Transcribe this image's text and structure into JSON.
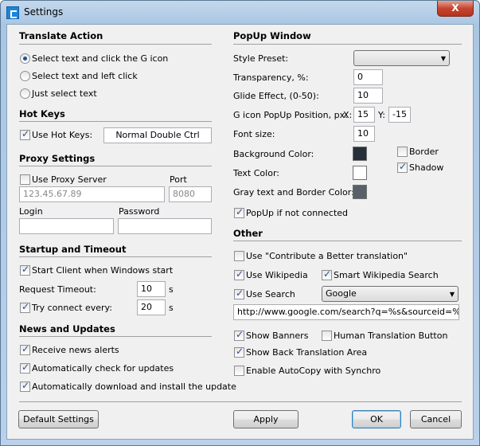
{
  "window": {
    "title": "Settings",
    "close": "X"
  },
  "translate": {
    "heading": "Translate Action",
    "options": [
      {
        "label": "Select text and click the G icon",
        "selected": true
      },
      {
        "label": "Select text and left click",
        "selected": false
      },
      {
        "label": "Just select text",
        "selected": false
      }
    ]
  },
  "hotkeys": {
    "heading": "Hot Keys",
    "use_label": "Use Hot Keys:",
    "checked": true,
    "value": "Normal Double Ctrl"
  },
  "proxy": {
    "heading": "Proxy Settings",
    "use_label": "Use Proxy Server",
    "port_label": "Port",
    "address": "123.45.67.89",
    "port": "8080",
    "login_label": "Login",
    "password_label": "Password",
    "login": "",
    "password": ""
  },
  "startup": {
    "heading": "Startup and Timeout",
    "start_label": "Start Client when Windows start",
    "timeout_label": "Request Timeout:",
    "timeout": "10",
    "unit": "s",
    "try_label": "Try connect every:",
    "try_value": "20"
  },
  "news": {
    "heading": "News and Updates",
    "items": [
      {
        "label": "Receive news alerts",
        "checked": true
      },
      {
        "label": "Automatically check for updates",
        "checked": true
      },
      {
        "label": "Automatically download and install the update",
        "checked": true
      }
    ]
  },
  "popup": {
    "heading": "PopUp Window",
    "style_label": "Style Preset:",
    "style_value": "",
    "transparency_label": "Transparency, %:",
    "transparency": "0",
    "glide_label": "Glide Effect, (0-50):",
    "glide": "10",
    "pos_label": "G icon PopUp Position, px:",
    "x_label": "X:",
    "x": "15",
    "y_label": "Y:",
    "y": "-15",
    "font_label": "Font size:",
    "font": "10",
    "bg_label": "Background Color:",
    "bg_color": "#262f3a",
    "text_label": "Text Color:",
    "text_color": "#ffffff",
    "gray_label": "Gray text and Border Color:",
    "gray_color": "#5a6068",
    "border_label": "Border",
    "shadow_label": "Shadow",
    "notconn_label": "PopUp if not connected"
  },
  "other": {
    "heading": "Other",
    "contribute": "Use \"Contribute a Better translation\"",
    "wikipedia": "Use Wikipedia",
    "smart_wiki": "Smart Wikipedia Search",
    "use_search": "Use Search",
    "search_engine": "Google",
    "search_url": "http://www.google.com/search?q=%s&sourceid=%tc&ie",
    "banners": "Show Banners",
    "human": "Human Translation Button",
    "back": "Show Back Translation Area",
    "autocopy": "Enable AutoCopy with Synchro"
  },
  "buttons": {
    "default": "Default Settings",
    "apply": "Apply",
    "ok": "OK",
    "cancel": "Cancel"
  }
}
